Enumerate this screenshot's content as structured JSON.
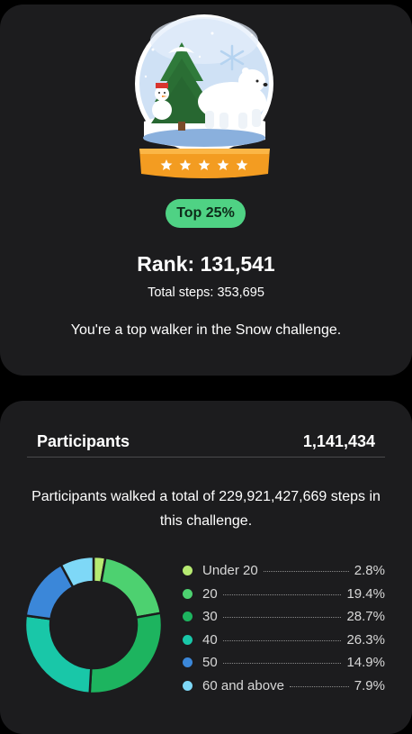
{
  "achievement": {
    "badge": "Top 25%",
    "rank_text": "Rank: 131,541",
    "total_steps_text": "Total steps: 353,695",
    "message": "You're a top walker in the Snow challenge."
  },
  "participants": {
    "title": "Participants",
    "count": "1,141,434",
    "summary": "Participants walked a total of 229,921,427,669 steps in this challenge."
  },
  "colors": {
    "background": "#000000",
    "card": "#1c1c1e",
    "badge": "#4fd284"
  },
  "chart_data": {
    "type": "pie",
    "categories": [
      "Under 20",
      "20",
      "30",
      "40",
      "50",
      "60 and above"
    ],
    "values": [
      2.8,
      19.4,
      28.7,
      26.3,
      14.9,
      7.9
    ],
    "value_labels": [
      "2.8%",
      "19.4%",
      "28.7%",
      "26.3%",
      "14.9%",
      "7.9%"
    ],
    "colors": [
      "#b6ea72",
      "#4dd170",
      "#1db45f",
      "#19c7a8",
      "#3b87d9",
      "#7ed8f7"
    ],
    "legend_position": "right"
  }
}
